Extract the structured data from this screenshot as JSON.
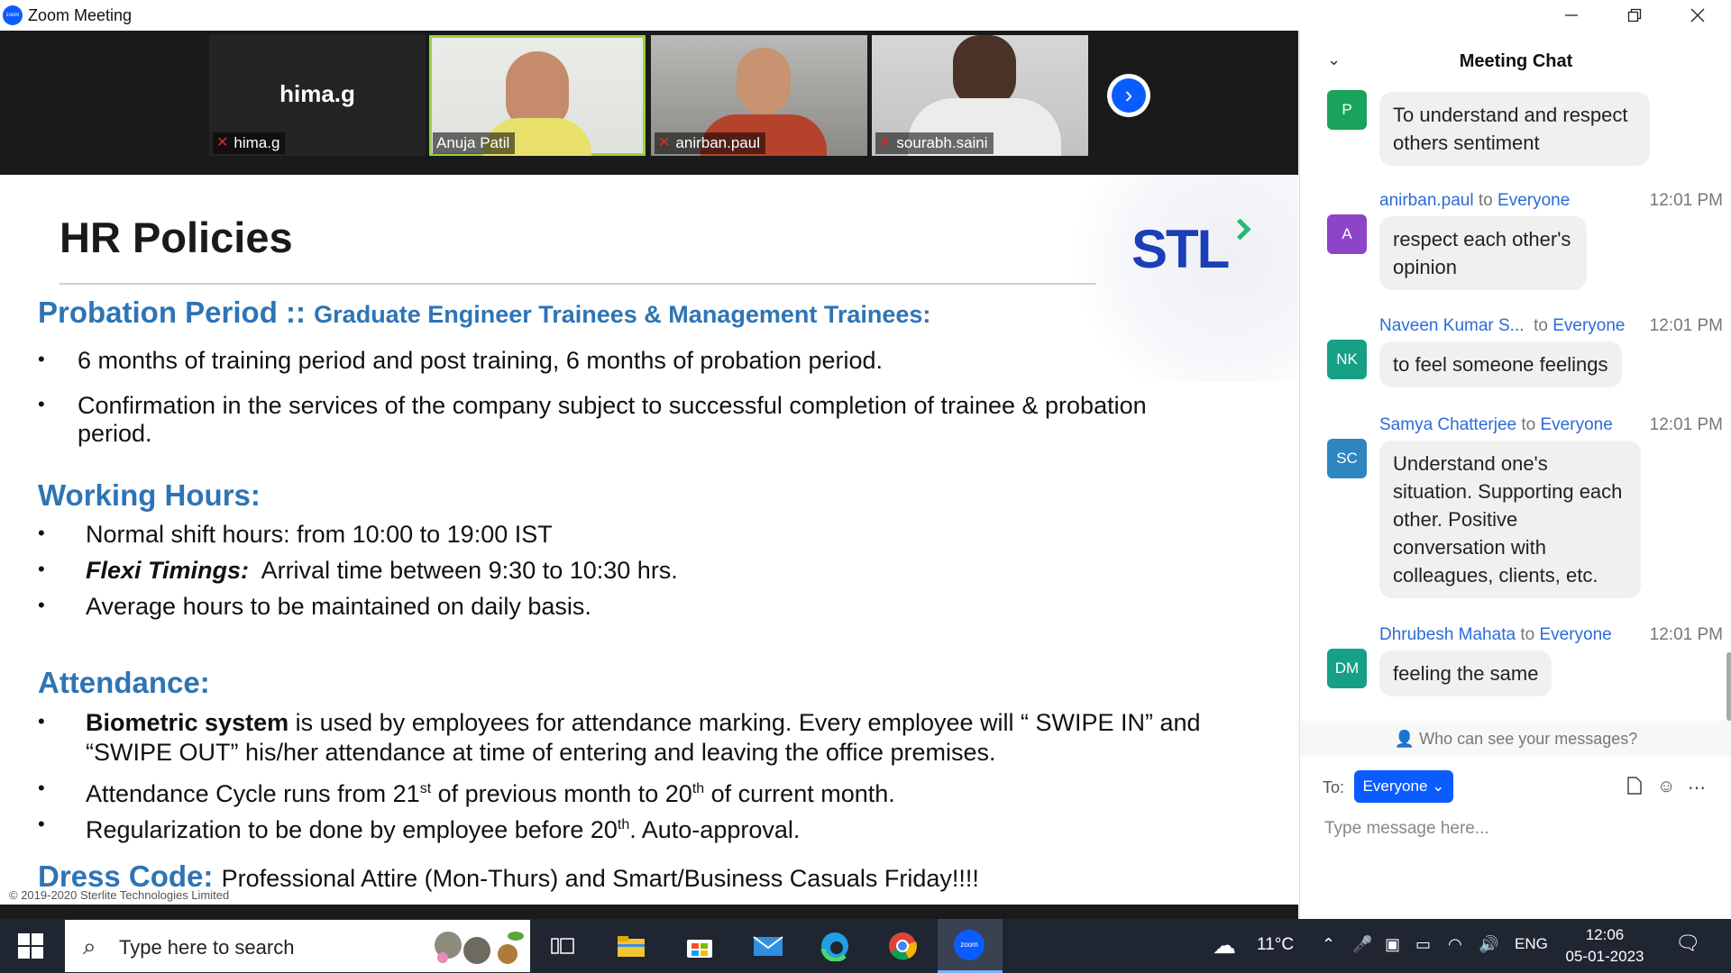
{
  "window": {
    "title": "Zoom Meeting"
  },
  "participants": [
    {
      "name": "hima.g",
      "label": "hima.g",
      "muted": true
    },
    {
      "name": "Anuja Patil",
      "muted": false,
      "active_speaker": true
    },
    {
      "name": "anirban.paul",
      "muted": true
    },
    {
      "name": "sourabh.saini",
      "muted": true
    }
  ],
  "slide": {
    "title": "HR Policies",
    "logo": "STL",
    "probation": {
      "heading": "Probation Period ::",
      "subheading": "Graduate Engineer Trainees & Management Trainees:",
      "b1": "6 months of training period and post training, 6 months of probation period.",
      "b2": "Confirmation in the services of the company subject to successful completion of trainee & probation period."
    },
    "working": {
      "heading": "Working Hours:",
      "b1": "Normal shift hours: from 10:00 to 19:00 IST",
      "b2_label": "Flexi Timings:",
      "b2": "Arrival time between 9:30 to 10:30 hrs.",
      "b3": "Average hours to be maintained on daily basis."
    },
    "attendance": {
      "heading": "Attendance:",
      "b1_bold": "Biometric system",
      "b1": "is used by employees for attendance marking. Every employee will “ SWIPE IN” and “SWIPE OUT” his/her attendance at time of entering and leaving the office premises.",
      "b2_a": "Attendance Cycle runs from 21",
      "b2_sup1": "st",
      "b2_b": " of previous month to 20",
      "b2_sup2": "th",
      "b2_c": " of current month.",
      "b3_a": "Regularization to be done by employee before 20",
      "b3_sup": "th",
      "b3_b": ". Auto-approval."
    },
    "dress": {
      "heading": "Dress Code:",
      "text": "Professional Attire (Mon-Thurs) and Smart/Business Casuals Friday!!!!"
    },
    "copyright": "© 2019-2020 Sterlite Technologies Limited"
  },
  "chat": {
    "title": "Meeting Chat",
    "messages": [
      {
        "initials": "P",
        "color": "#1aa35a",
        "text": "To understand and respect others sentiment"
      },
      {
        "initials": "A",
        "color": "#8e44c9",
        "sender": "anirban.paul",
        "to": "Everyone",
        "time": "12:01 PM",
        "text": "respect each other's opinion"
      },
      {
        "initials": "NK",
        "color": "#16a085",
        "sender": "Naveen Kumar S...",
        "to": "Everyone",
        "time": "12:01 PM",
        "text": "to feel someone feelings"
      },
      {
        "initials": "SC",
        "color": "#2e86c1",
        "sender": "Samya Chatterjee",
        "to": "Everyone",
        "time": "12:01 PM",
        "text": "Understand one's situation. Supporting each other. Positive conversation with colleagues, clients, etc."
      },
      {
        "initials": "DM",
        "color": "#16a085",
        "sender": "Dhrubesh Mahata",
        "to": "Everyone",
        "time": "12:01 PM",
        "text": "feeling the same"
      }
    ],
    "to_word": "to",
    "who_can_see": "Who can see your messages?",
    "to_label": "To:",
    "recipient": "Everyone",
    "input_placeholder": "Type message here..."
  },
  "taskbar": {
    "search_placeholder": "Type here to search",
    "weather": "11°C",
    "language": "ENG",
    "time": "12:06",
    "date": "05-01-2023",
    "zoom_label": "zoom"
  }
}
